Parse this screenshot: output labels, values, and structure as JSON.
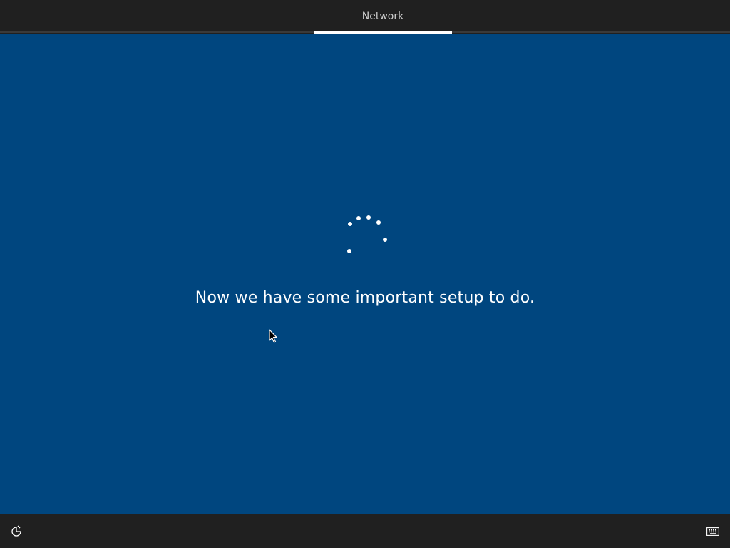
{
  "header": {
    "tabs": [
      {
        "label": "Network",
        "active": true
      }
    ]
  },
  "main": {
    "message": "Now we have some important setup to do.",
    "background_color": "#00467f",
    "loading_indicator": "spinner-icon"
  },
  "footer": {
    "left_icon": "ease-of-access-icon",
    "right_icon": "keyboard-icon"
  },
  "colors": {
    "chrome": "#202020",
    "accent_underline": "#ffffff",
    "text": "#ffffff"
  }
}
